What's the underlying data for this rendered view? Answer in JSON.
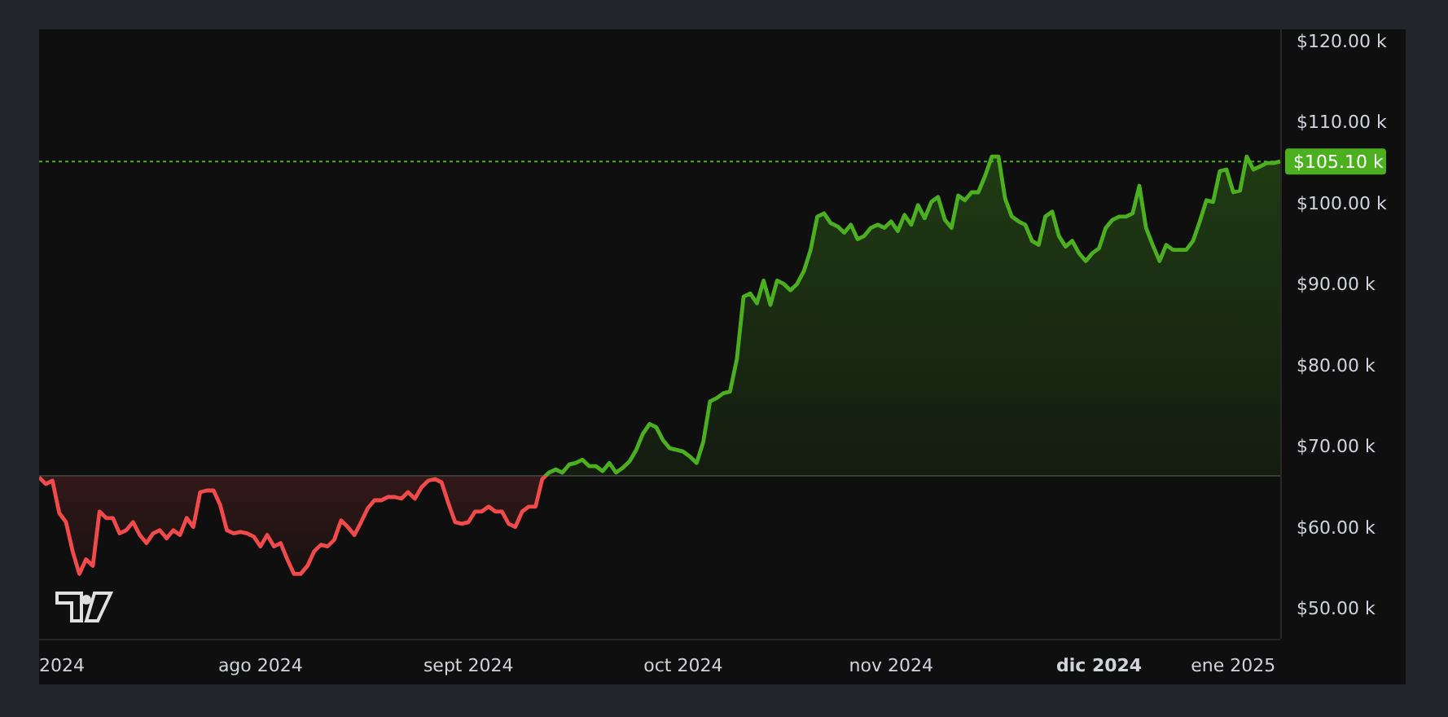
{
  "chart": {
    "chart_data": {
      "type": "area",
      "ylim": [
        46.2,
        121.4
      ],
      "categories": [
        null,
        null,
        null,
        "2024",
        null,
        null,
        null,
        null,
        null,
        null,
        null,
        null,
        null,
        null,
        null,
        null,
        null,
        null,
        null,
        null,
        null,
        null,
        null,
        null,
        null,
        null,
        null,
        null,
        null,
        null,
        null,
        null,
        null,
        "ago 2024",
        null,
        null,
        null,
        null,
        null,
        null,
        null,
        null,
        null,
        null,
        null,
        null,
        null,
        null,
        null,
        null,
        null,
        null,
        null,
        null,
        null,
        null,
        null,
        null,
        null,
        null,
        null,
        null,
        null,
        null,
        "sept 2024",
        null,
        null,
        null,
        null,
        null,
        null,
        null,
        null,
        null,
        null,
        null,
        null,
        null,
        null,
        null,
        null,
        null,
        null,
        null,
        null,
        null,
        null,
        null,
        null,
        null,
        null,
        null,
        null,
        null,
        null,
        null,
        "oct 2024",
        null,
        null,
        null,
        null,
        null,
        null,
        null,
        null,
        null,
        null,
        null,
        null,
        null,
        null,
        null,
        null,
        null,
        null,
        null,
        null,
        null,
        null,
        null,
        null,
        null,
        null,
        null,
        null,
        null,
        null,
        "nov 2024",
        null,
        null,
        null,
        null,
        null,
        null,
        null,
        null,
        null,
        null,
        null,
        null,
        null,
        null,
        null,
        null,
        null,
        null,
        null,
        null,
        null,
        null,
        null,
        null,
        null,
        null,
        null,
        null,
        null,
        null,
        "dic 2024",
        null,
        null,
        null,
        null,
        null,
        null,
        null,
        null,
        null,
        null,
        null,
        null,
        null,
        null,
        null,
        null,
        null,
        null,
        null,
        "ene 2025",
        null,
        null,
        null,
        null,
        null,
        null,
        null
      ],
      "yticks": [
        {
          "value": 50,
          "label": "$50.00 k"
        },
        {
          "value": 60,
          "label": "$60.00 k"
        },
        {
          "value": 70,
          "label": "$70.00 k"
        },
        {
          "value": 80,
          "label": "$80.00 k"
        },
        {
          "value": 90,
          "label": "$90.00 k"
        },
        {
          "value": 100,
          "label": "$100.00 k"
        },
        {
          "value": 110,
          "label": "$110.00 k"
        },
        {
          "value": 120,
          "label": "$120.00 k"
        }
      ],
      "series": [
        {
          "color": "#4caf1f",
          "values": [
            66.1,
            65.3,
            65.7,
            61.7,
            60.6,
            57.0,
            54.2,
            56.0,
            55.2,
            61.9,
            61.1,
            61.1,
            59.2,
            59.6,
            60.6,
            59.0,
            58.0,
            59.2,
            59.6,
            58.6,
            59.6,
            59.0,
            61.1,
            60.0,
            64.3,
            64.5,
            64.5,
            62.7,
            59.6,
            59.2,
            59.4,
            59.2,
            58.8,
            57.6,
            59.0,
            57.6,
            58.0,
            56.0,
            54.2,
            54.2,
            55.2,
            57.0,
            57.8,
            57.6,
            58.4,
            60.8,
            60.0,
            59.0,
            60.6,
            62.3,
            63.3,
            63.3,
            63.7,
            63.7,
            63.5,
            64.3,
            63.5,
            64.9,
            65.7,
            65.9,
            65.5,
            62.9,
            60.6,
            60.4,
            60.6,
            61.9,
            61.9,
            62.5,
            61.9,
            61.9,
            60.4,
            60.0,
            61.9,
            62.5,
            62.5,
            65.9,
            66.7,
            67.1,
            66.7,
            67.7,
            67.9,
            68.3,
            67.5,
            67.5,
            66.9,
            67.9,
            66.7,
            67.3,
            68.1,
            69.5,
            71.5,
            72.7,
            72.3,
            70.7,
            69.7,
            69.5,
            69.3,
            68.7,
            67.9,
            70.5,
            75.5,
            75.9,
            76.5,
            76.7,
            80.7,
            88.4,
            88.8,
            87.6,
            90.4,
            87.4,
            90.4,
            90.0,
            89.2,
            90.0,
            91.6,
            94.2,
            98.3,
            98.7,
            97.5,
            97.1,
            96.3,
            97.3,
            95.5,
            95.9,
            96.9,
            97.3,
            96.9,
            97.7,
            96.5,
            98.5,
            97.3,
            99.7,
            98.1,
            100.1,
            100.7,
            97.9,
            96.9,
            100.9,
            100.3,
            101.3,
            101.3,
            103.3,
            105.7,
            105.7,
            100.5,
            98.3,
            97.7,
            97.3,
            95.3,
            94.8,
            98.3,
            98.9,
            95.9,
            94.6,
            95.3,
            93.8,
            92.8,
            93.8,
            94.4,
            96.9,
            97.9,
            98.3,
            98.3,
            98.7,
            102.1,
            96.9,
            94.8,
            92.8,
            94.8,
            94.2,
            94.2,
            94.2,
            95.3,
            97.7,
            100.3,
            100.1,
            103.9,
            104.1,
            101.3,
            101.5,
            105.7,
            104.1,
            104.5,
            104.9,
            104.9,
            105.1
          ]
        }
      ],
      "ref_lines": [
        {
          "axis": "y",
          "value": 66.3
        },
        {
          "axis": "y",
          "value": 105.1,
          "label": "$105.10 k"
        }
      ]
    },
    "xtick_styles": [
      {
        "bold": false
      },
      {
        "bold": false
      },
      {
        "bold": false
      },
      {
        "bold": false
      },
      {
        "bold": false
      },
      {
        "bold": true
      },
      {
        "bold": false
      }
    ]
  }
}
